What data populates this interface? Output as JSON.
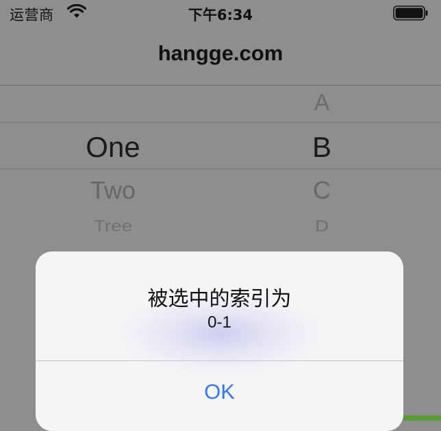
{
  "status_bar": {
    "carrier": "运营商",
    "time": "下午6:34",
    "wifi_icon": "wifi-icon",
    "battery_icon": "battery-icon"
  },
  "nav": {
    "title": "hangge.com"
  },
  "picker": {
    "column_left": {
      "items": [
        "One",
        "Two",
        "Tree"
      ],
      "selected_index": 0
    },
    "column_right": {
      "items": [
        "A",
        "B",
        "C",
        "D"
      ],
      "selected_index": 1
    }
  },
  "alert": {
    "title": "被选中的索引为",
    "message": "0-1",
    "ok_label": "OK"
  },
  "colors": {
    "dim_overlay": "#8e8e8e",
    "alert_background": "#f5f5f6",
    "ok_button": "#3478f6"
  }
}
